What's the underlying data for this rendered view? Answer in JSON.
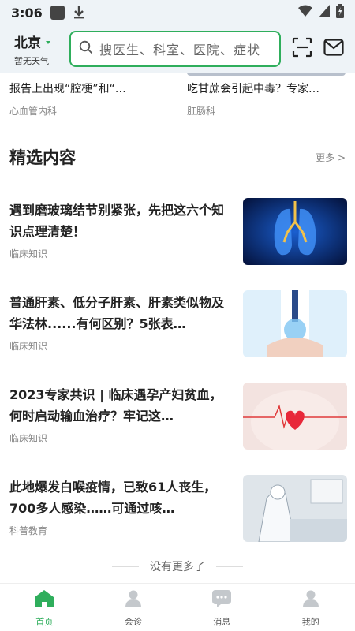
{
  "status_bar": {
    "time": "3:06"
  },
  "header": {
    "city": "北京",
    "weather": "暂无天气",
    "search_placeholder": "搜医生、科室、医院、症状"
  },
  "top_cards": [
    {
      "title": "报告上出现“腔梗”和“…",
      "tag": "心血管内科"
    },
    {
      "title": "吃甘蔗会引起中毒？专家…",
      "tag": "肛肠科"
    }
  ],
  "section": {
    "title": "精选内容",
    "more": "更多 >"
  },
  "articles": [
    {
      "title": "遇到磨玻璃结节别紧张，先把这六个知识点理清楚！",
      "tag": "临床知识"
    },
    {
      "title": "普通肝素、低分子肝素、肝素类似物及华法林......有何区别？5张表…",
      "tag": "临床知识"
    },
    {
      "title": "2023专家共识 | 临床遇孕产妇贫血，何时启动输血治疗？牢记这…",
      "tag": "临床知识"
    },
    {
      "title": "此地爆发白喉疫情，已致61人丧生，700多人感染……可通过咳…",
      "tag": "科普教育"
    }
  ],
  "footer_note": "没有更多了",
  "tabs": [
    {
      "label": "首页",
      "icon": "home-icon",
      "active": true
    },
    {
      "label": "会诊",
      "icon": "consult-icon",
      "active": false
    },
    {
      "label": "消息",
      "icon": "message-icon",
      "active": false
    },
    {
      "label": "我的",
      "icon": "profile-icon",
      "active": false
    }
  ],
  "colors": {
    "accent": "#2fae5c",
    "header_bg": "#eef3f7"
  }
}
